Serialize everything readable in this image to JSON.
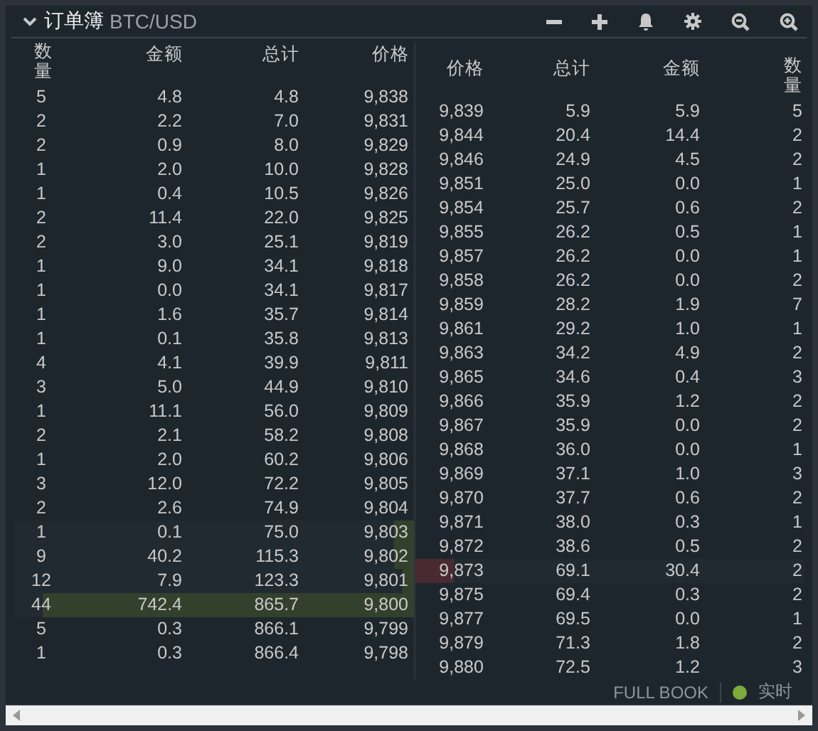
{
  "header": {
    "title": "订单簿",
    "pair": "BTC/USD"
  },
  "bids": {
    "columns": [
      "数量",
      "金额",
      "总计",
      "价格"
    ],
    "rows": [
      {
        "count": "5",
        "amount": "4.8",
        "total": "4.8",
        "price": "9,838"
      },
      {
        "count": "2",
        "amount": "2.2",
        "total": "7.0",
        "price": "9,831"
      },
      {
        "count": "2",
        "amount": "0.9",
        "total": "8.0",
        "price": "9,829"
      },
      {
        "count": "1",
        "amount": "2.0",
        "total": "10.0",
        "price": "9,828"
      },
      {
        "count": "1",
        "amount": "0.4",
        "total": "10.5",
        "price": "9,826"
      },
      {
        "count": "2",
        "amount": "11.4",
        "total": "22.0",
        "price": "9,825"
      },
      {
        "count": "2",
        "amount": "3.0",
        "total": "25.1",
        "price": "9,819"
      },
      {
        "count": "1",
        "amount": "9.0",
        "total": "34.1",
        "price": "9,818"
      },
      {
        "count": "1",
        "amount": "0.0",
        "total": "34.1",
        "price": "9,817"
      },
      {
        "count": "1",
        "amount": "1.6",
        "total": "35.7",
        "price": "9,814"
      },
      {
        "count": "1",
        "amount": "0.1",
        "total": "35.8",
        "price": "9,813"
      },
      {
        "count": "4",
        "amount": "4.1",
        "total": "39.9",
        "price": "9,811"
      },
      {
        "count": "3",
        "amount": "5.0",
        "total": "44.9",
        "price": "9,810"
      },
      {
        "count": "1",
        "amount": "11.1",
        "total": "56.0",
        "price": "9,809"
      },
      {
        "count": "2",
        "amount": "2.1",
        "total": "58.2",
        "price": "9,808"
      },
      {
        "count": "1",
        "amount": "2.0",
        "total": "60.2",
        "price": "9,806"
      },
      {
        "count": "3",
        "amount": "12.0",
        "total": "72.2",
        "price": "9,805"
      },
      {
        "count": "2",
        "amount": "2.6",
        "total": "74.9",
        "price": "9,804"
      },
      {
        "count": "1",
        "amount": "0.1",
        "total": "75.0",
        "price": "9,803",
        "level": 0.05
      },
      {
        "count": "9",
        "amount": "40.2",
        "total": "115.3",
        "price": "9,802",
        "level": 0.05
      },
      {
        "count": "12",
        "amount": "7.9",
        "total": "123.3",
        "price": "9,801",
        "level": 0.03
      },
      {
        "count": "44",
        "amount": "742.4",
        "total": "865.7",
        "price": "9,800",
        "level": 0.93
      },
      {
        "count": "5",
        "amount": "0.3",
        "total": "866.1",
        "price": "9,799"
      },
      {
        "count": "1",
        "amount": "0.3",
        "total": "866.4",
        "price": "9,798"
      }
    ]
  },
  "asks": {
    "columns": [
      "价格",
      "总计",
      "金额",
      "数量"
    ],
    "rows": [
      {
        "price": "9,839",
        "total": "5.9",
        "amount": "5.9",
        "count": "5"
      },
      {
        "price": "9,844",
        "total": "20.4",
        "amount": "14.4",
        "count": "2"
      },
      {
        "price": "9,846",
        "total": "24.9",
        "amount": "4.5",
        "count": "2"
      },
      {
        "price": "9,851",
        "total": "25.0",
        "amount": "0.0",
        "count": "1"
      },
      {
        "price": "9,854",
        "total": "25.7",
        "amount": "0.6",
        "count": "2"
      },
      {
        "price": "9,855",
        "total": "26.2",
        "amount": "0.5",
        "count": "1"
      },
      {
        "price": "9,857",
        "total": "26.2",
        "amount": "0.0",
        "count": "1"
      },
      {
        "price": "9,858",
        "total": "26.2",
        "amount": "0.0",
        "count": "2"
      },
      {
        "price": "9,859",
        "total": "28.2",
        "amount": "1.9",
        "count": "7"
      },
      {
        "price": "9,861",
        "total": "29.2",
        "amount": "1.0",
        "count": "1"
      },
      {
        "price": "9,863",
        "total": "34.2",
        "amount": "4.9",
        "count": "2"
      },
      {
        "price": "9,865",
        "total": "34.6",
        "amount": "0.4",
        "count": "3"
      },
      {
        "price": "9,866",
        "total": "35.9",
        "amount": "1.2",
        "count": "2"
      },
      {
        "price": "9,867",
        "total": "35.9",
        "amount": "0.0",
        "count": "2"
      },
      {
        "price": "9,868",
        "total": "36.0",
        "amount": "0.0",
        "count": "1"
      },
      {
        "price": "9,869",
        "total": "37.1",
        "amount": "1.0",
        "count": "3"
      },
      {
        "price": "9,870",
        "total": "37.7",
        "amount": "0.6",
        "count": "2"
      },
      {
        "price": "9,871",
        "total": "38.0",
        "amount": "0.3",
        "count": "1"
      },
      {
        "price": "9,872",
        "total": "38.6",
        "amount": "0.5",
        "count": "2"
      },
      {
        "price": "9,873",
        "total": "69.1",
        "amount": "30.4",
        "count": "2",
        "level": 0.1
      },
      {
        "price": "9,875",
        "total": "69.4",
        "amount": "0.3",
        "count": "2"
      },
      {
        "price": "9,877",
        "total": "69.5",
        "amount": "0.0",
        "count": "1"
      },
      {
        "price": "9,879",
        "total": "71.3",
        "amount": "1.8",
        "count": "2"
      },
      {
        "price": "9,880",
        "total": "72.5",
        "amount": "1.2",
        "count": "3"
      }
    ]
  },
  "footer": {
    "mode": "FULL BOOK",
    "live": "实时"
  }
}
